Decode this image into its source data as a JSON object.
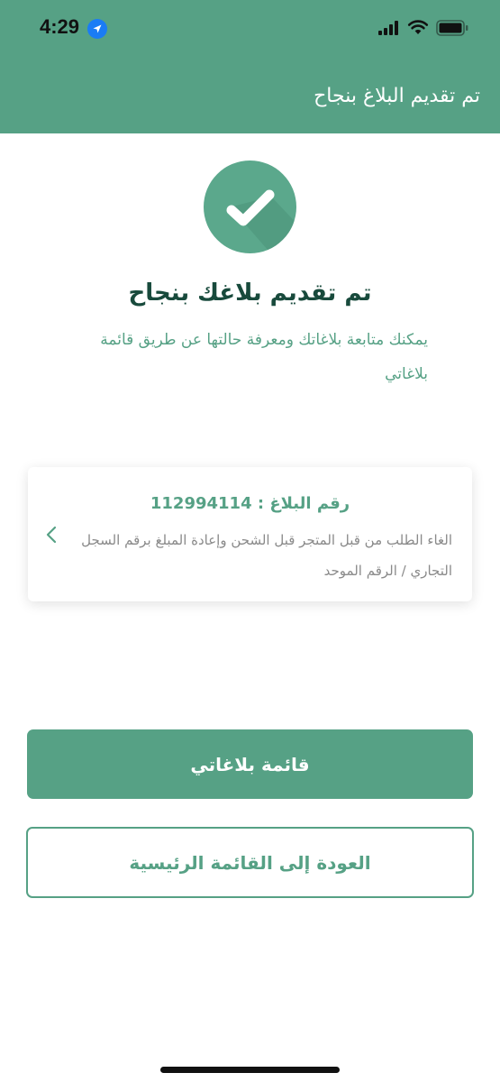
{
  "status_bar": {
    "time": "4:29"
  },
  "header": {
    "title": "تم تقديم البلاغ بنجاح"
  },
  "success": {
    "title": "تم تقديم بلاغك بنجاح",
    "description": "يمكنك متابعة بلاغاتك ومعرفة حالتها عن طريق قائمة بلاغاتي"
  },
  "report_card": {
    "number_text": "رقم البلاغ : 112994114",
    "description": "الغاء الطلب من قبل المتجر قبل الشحن وإعادة المبلغ برقم السجل التجاري / الرقم الموحد"
  },
  "buttons": {
    "my_reports": "قائمة بلاغاتي",
    "back_home": "العودة إلى القائمة الرئيسية"
  },
  "colors": {
    "primary": "#56a185",
    "title_dark": "#184a3c",
    "muted_text": "#8a8a8a"
  }
}
